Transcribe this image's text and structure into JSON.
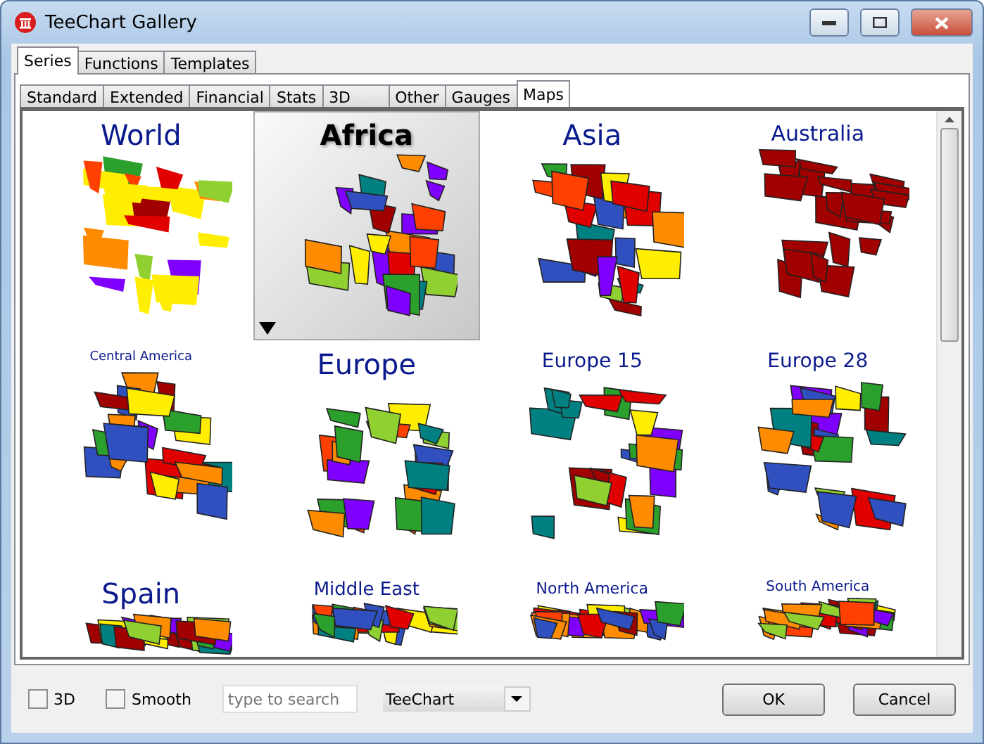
{
  "window": {
    "title": "TeeChart Gallery"
  },
  "tabs": [
    {
      "label": "Series",
      "selected": true
    },
    {
      "label": "Functions",
      "selected": false
    },
    {
      "label": "Templates",
      "selected": false
    }
  ],
  "subtabs": [
    {
      "label": "Standard",
      "selected": false
    },
    {
      "label": "Extended",
      "selected": false
    },
    {
      "label": "Financial",
      "selected": false
    },
    {
      "label": "Stats",
      "selected": false
    },
    {
      "label": "3D",
      "selected": false
    },
    {
      "label": "Other",
      "selected": false
    },
    {
      "label": "Gauges",
      "selected": false
    },
    {
      "label": "Maps",
      "selected": true
    }
  ],
  "gallery": [
    {
      "title": "World",
      "selected": false
    },
    {
      "title": "Africa",
      "selected": true
    },
    {
      "title": "Asia",
      "selected": false
    },
    {
      "title": "Australia",
      "selected": false
    },
    {
      "title": "Central America",
      "selected": false
    },
    {
      "title": "Europe",
      "selected": false
    },
    {
      "title": "Europe 15",
      "selected": false
    },
    {
      "title": "Europe 28",
      "selected": false
    },
    {
      "title": "Spain",
      "selected": false
    },
    {
      "title": "Middle East",
      "selected": false
    },
    {
      "title": "North America",
      "selected": false
    },
    {
      "title": "South America",
      "selected": false
    }
  ],
  "options": [
    {
      "label": "3D",
      "checked": false
    },
    {
      "label": "Smooth",
      "checked": false
    }
  ],
  "search": {
    "placeholder": "type to search"
  },
  "theme_select": {
    "value": "TeeChart"
  },
  "buttons": [
    "OK",
    "Cancel"
  ]
}
